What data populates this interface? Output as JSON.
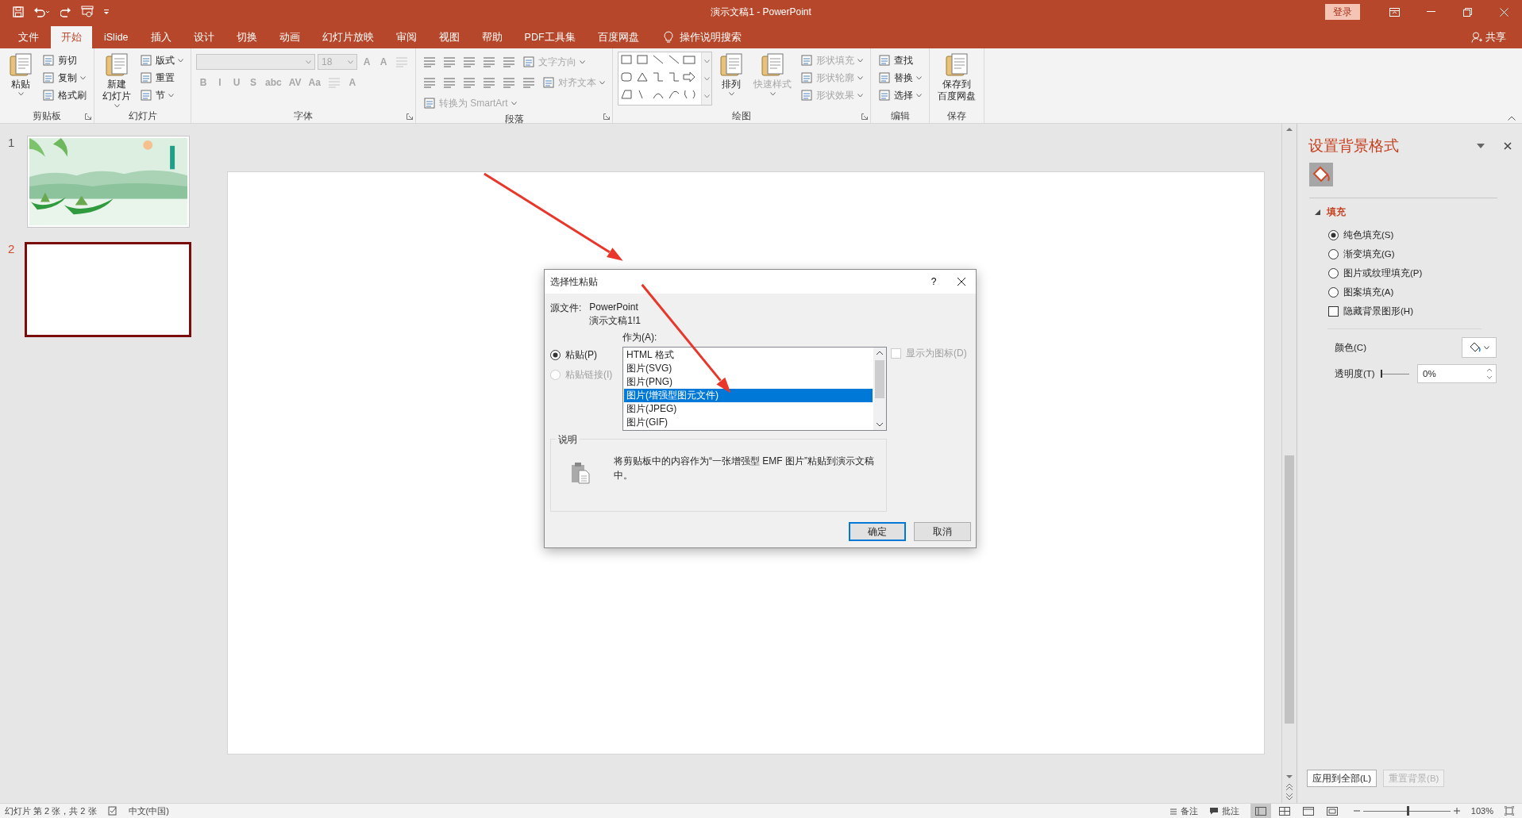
{
  "title_bar": {
    "title": "演示文稿1 - PowerPoint",
    "login": "登录"
  },
  "tabs": [
    {
      "label": "文件",
      "selected": false
    },
    {
      "label": "开始",
      "selected": true
    },
    {
      "label": "iSlide",
      "selected": false
    },
    {
      "label": "插入",
      "selected": false
    },
    {
      "label": "设计",
      "selected": false
    },
    {
      "label": "切换",
      "selected": false
    },
    {
      "label": "动画",
      "selected": false
    },
    {
      "label": "幻灯片放映",
      "selected": false
    },
    {
      "label": "审阅",
      "selected": false
    },
    {
      "label": "视图",
      "selected": false
    },
    {
      "label": "帮助",
      "selected": false
    },
    {
      "label": "PDF工具集",
      "selected": false
    },
    {
      "label": "百度网盘",
      "selected": false
    }
  ],
  "tell_me": "操作说明搜索",
  "share": "共享",
  "ribbon": {
    "groups": [
      {
        "label": "剪贴板",
        "kind": "stack",
        "launcher": true,
        "items": [
          {
            "kind": "large",
            "label": "粘贴",
            "dropdown": true,
            "disabled": false
          },
          {
            "kind": "small",
            "label": "剪切",
            "dropdown": false,
            "disabled": false
          },
          {
            "kind": "small",
            "label": "复制",
            "dropdown": true,
            "disabled": false
          },
          {
            "kind": "small",
            "label": "格式刷",
            "dropdown": false,
            "disabled": false
          }
        ]
      },
      {
        "label": "幻灯片",
        "kind": "stack",
        "launcher": false,
        "items": [
          {
            "kind": "large",
            "lines": [
              "新建",
              "幻灯片"
            ],
            "dropdown": true,
            "disabled": false
          },
          {
            "kind": "small",
            "label": "版式",
            "dropdown": true,
            "disabled": false
          },
          {
            "kind": "small",
            "label": "重置",
            "dropdown": false,
            "disabled": false
          },
          {
            "kind": "small",
            "label": "节",
            "dropdown": true,
            "disabled": false
          }
        ]
      },
      {
        "label": "字体",
        "kind": "rows",
        "launcher": true,
        "rows": [
          [
            {
              "kind": "combo",
              "disabled": true,
              "wide": true
            },
            {
              "kind": "combo",
              "value": "18",
              "disabled": true,
              "wide": false
            },
            {
              "kind": "glyph",
              "text": "A",
              "disabled": true
            },
            {
              "kind": "glyph",
              "text": "A",
              "disabled": true
            },
            {
              "kind": "tool",
              "disabled": true
            }
          ],
          [
            {
              "kind": "glyph",
              "text": "B",
              "disabled": true
            },
            {
              "kind": "glyph",
              "text": "I",
              "disabled": true
            },
            {
              "kind": "glyph",
              "text": "U",
              "disabled": true
            },
            {
              "kind": "glyph",
              "text": "S",
              "disabled": true
            },
            {
              "kind": "glyph",
              "text": "abc",
              "disabled": true
            },
            {
              "kind": "glyph",
              "text": "AV",
              "disabled": true
            },
            {
              "kind": "glyph",
              "text": "Aa",
              "disabled": true
            },
            {
              "kind": "tool",
              "disabled": true
            },
            {
              "kind": "glyph",
              "text": "A",
              "disabled": true
            }
          ]
        ]
      },
      {
        "label": "段落",
        "kind": "rows",
        "launcher": true,
        "rows": [
          [
            {
              "kind": "tool",
              "disabled": false
            },
            {
              "kind": "tool",
              "disabled": false
            },
            {
              "kind": "tool",
              "disabled": false
            },
            {
              "kind": "tool",
              "disabled": false
            },
            {
              "kind": "tool",
              "disabled": false
            },
            {
              "kind": "small",
              "label": "文字方向",
              "dropdown": true,
              "disabled": true
            }
          ],
          [
            {
              "kind": "tool",
              "disabled": false
            },
            {
              "kind": "tool",
              "disabled": false
            },
            {
              "kind": "tool",
              "disabled": false
            },
            {
              "kind": "tool",
              "disabled": false
            },
            {
              "kind": "tool",
              "disabled": false
            },
            {
              "kind": "tool",
              "disabled": false
            },
            {
              "kind": "small",
              "label": "对齐文本",
              "dropdown": true,
              "disabled": true
            }
          ],
          [
            {
              "kind": "small",
              "label": "转换为 SmartArt",
              "dropdown": true,
              "disabled": true
            }
          ]
        ]
      },
      {
        "label": "绘图",
        "kind": "stack",
        "launcher": true,
        "items": [
          {
            "kind": "gallery"
          },
          {
            "kind": "large",
            "label": "排列",
            "dropdown": true,
            "disabled": false
          },
          {
            "kind": "large",
            "label": "快速样式",
            "dropdown": true,
            "disabled": true
          },
          {
            "kind": "small",
            "label": "形状填充",
            "dropdown": true,
            "disabled": true
          },
          {
            "kind": "small",
            "label": "形状轮廓",
            "dropdown": true,
            "disabled": true
          },
          {
            "kind": "small",
            "label": "形状效果",
            "dropdown": true,
            "disabled": true
          }
        ]
      },
      {
        "label": "编辑",
        "kind": "stack",
        "launcher": false,
        "items": [
          {
            "kind": "small",
            "label": "查找",
            "dropdown": false,
            "disabled": false
          },
          {
            "kind": "small",
            "label": "替换",
            "dropdown": true,
            "disabled": false
          },
          {
            "kind": "small",
            "label": "选择",
            "dropdown": true,
            "disabled": false
          }
        ]
      },
      {
        "label": "保存",
        "kind": "stack",
        "launcher": false,
        "items": [
          {
            "kind": "large",
            "lines": [
              "保存到",
              "百度网盘"
            ],
            "dropdown": false,
            "disabled": false
          }
        ]
      }
    ]
  },
  "slides": [
    {
      "number": "1",
      "selected": false,
      "kind": "picture"
    },
    {
      "number": "2",
      "selected": true,
      "kind": "blank"
    }
  ],
  "dialog": {
    "title": "选择性粘贴",
    "help": "?",
    "source_label": "源文件:",
    "source": [
      "PowerPoint",
      "演示文稿1!1"
    ],
    "as_label": "作为(A):",
    "modes": [
      {
        "label": "粘贴(P)",
        "selected": true,
        "disabled": false
      },
      {
        "label": "粘贴链接(I)",
        "selected": false,
        "disabled": true
      }
    ],
    "formats": [
      {
        "label": "HTML 格式",
        "selected": false
      },
      {
        "label": "图片(SVG)",
        "selected": false
      },
      {
        "label": "图片(PNG)",
        "selected": false
      },
      {
        "label": "图片(增强型图元文件)",
        "selected": true
      },
      {
        "label": "图片(JPEG)",
        "selected": false
      },
      {
        "label": "图片(GIF)",
        "selected": false
      }
    ],
    "show_as_icon": {
      "label": "显示为图标(D)",
      "checked": false,
      "disabled": true
    },
    "result_label": "说明",
    "result": "将剪贴板中的内容作为“一张增强型 EMF 图片”粘贴到演示文稿中。",
    "buttons": [
      {
        "label": "确定",
        "default": true
      },
      {
        "label": "取消",
        "default": false
      }
    ]
  },
  "format_pane": {
    "title": "设置背景格式",
    "section": {
      "label": "填充",
      "expanded": true
    },
    "fill_options": [
      {
        "label": "纯色填充(S)",
        "selected": true
      },
      {
        "label": "渐变填充(G)",
        "selected": false
      },
      {
        "label": "图片或纹理填充(P)",
        "selected": false
      },
      {
        "label": "图案填充(A)",
        "selected": false
      }
    ],
    "hide_graphics": {
      "label": "隐藏背景图形(H)",
      "checked": false
    },
    "color_label": "颜色(C)",
    "transparency_label": "透明度(T)",
    "transparency": {
      "value": "0%",
      "level": 0
    },
    "buttons": [
      {
        "label": "应用到全部(L)",
        "disabled": false
      },
      {
        "label": "重置背景(B)",
        "disabled": true
      }
    ]
  },
  "status_bar": {
    "slide_info": "幻灯片 第 2 张，共 2 张",
    "language": "中文(中国)",
    "notes": "备注",
    "comments": "批注",
    "views": [
      {
        "selected": true
      },
      {
        "selected": false
      },
      {
        "selected": false
      },
      {
        "selected": false
      }
    ],
    "zoom_slider": {
      "level": 0.52
    },
    "zoom": "103%"
  }
}
